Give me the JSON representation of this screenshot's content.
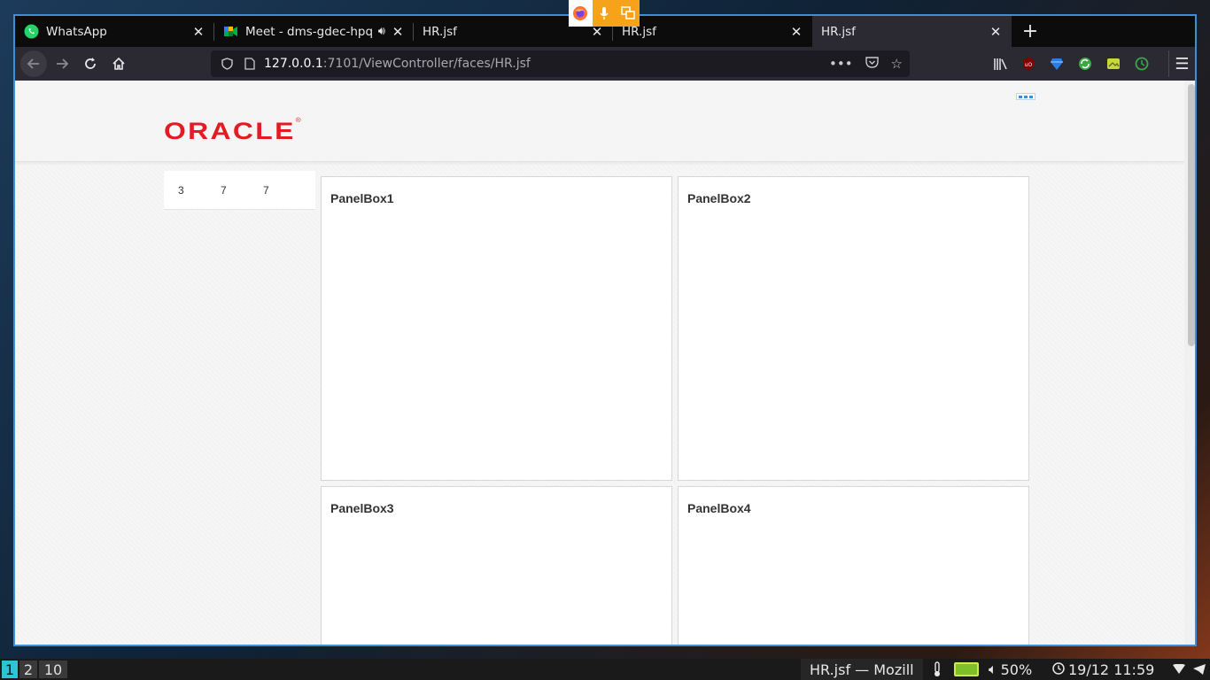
{
  "browser": {
    "tabs": [
      {
        "label": "WhatsApp",
        "icon": "whatsapp-icon",
        "active": false
      },
      {
        "label": "Meet - dms-gdec-hpq",
        "icon": "google-meet-icon",
        "audio": true,
        "active": false
      },
      {
        "label": "HR.jsf",
        "icon": "",
        "active": false
      },
      {
        "label": "HR.jsf",
        "icon": "",
        "active": false
      },
      {
        "label": "HR.jsf",
        "icon": "",
        "active": true
      }
    ],
    "url": {
      "host": "127.0.0.1",
      "path": ":7101/ViewController/faces/HR.jsf"
    },
    "accent_color": "#3c8fd8"
  },
  "page": {
    "logo": "ORACLE",
    "logo_mark": "®",
    "logo_color": "#e31b23",
    "stats": [
      "3",
      "7",
      "7"
    ],
    "panels": [
      {
        "title": "PanelBox1"
      },
      {
        "title": "PanelBox2"
      },
      {
        "title": "PanelBox3"
      },
      {
        "title": "PanelBox4"
      }
    ]
  },
  "taskbar": {
    "workspaces": [
      "1",
      "2",
      "10"
    ],
    "window_title": "HR.jsf — Mozill",
    "volume": "50%",
    "datetime": "19/12 11:59"
  }
}
